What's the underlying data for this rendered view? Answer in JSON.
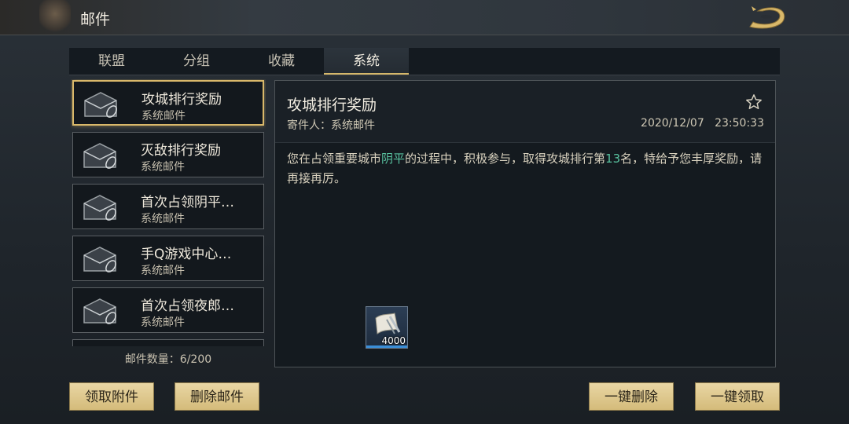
{
  "header": {
    "title": "邮件"
  },
  "tabs": [
    {
      "label": "联盟"
    },
    {
      "label": "分组"
    },
    {
      "label": "收藏"
    },
    {
      "label": "系统"
    }
  ],
  "mail_list": [
    {
      "title": "攻城排行奖励",
      "sender": "系统邮件"
    },
    {
      "title": "灭敌排行奖励",
      "sender": "系统邮件"
    },
    {
      "title": "首次占领阴平…",
      "sender": "系统邮件"
    },
    {
      "title": "手Q游戏中心…",
      "sender": "系统邮件"
    },
    {
      "title": "首次占领夜郎…",
      "sender": "系统邮件"
    }
  ],
  "mail_count": "邮件数量：6/200",
  "detail": {
    "subject": "攻城排行奖励",
    "sender_label": "寄件人：系统邮件",
    "date": "2020/12/07",
    "time": "23:50:33",
    "body_parts": {
      "p1": "您在占领重要城市",
      "city": "阴平",
      "p2": "的过程中，积极参与，取得攻城排行第",
      "rank": "13",
      "p3": "名，特给予您丰厚奖励，请再接再厉。"
    },
    "attachment": {
      "icon": "decree-scroll-icon",
      "quantity": "4000"
    }
  },
  "buttons": {
    "claim_attachment": "领取附件",
    "delete_mail": "删除邮件",
    "delete_all": "一键删除",
    "claim_all": "一键领取"
  },
  "colors": {
    "accent_gold": "#d9b86a",
    "highlight_green": "#59c3a0",
    "button_fill": "#e0c98e"
  }
}
